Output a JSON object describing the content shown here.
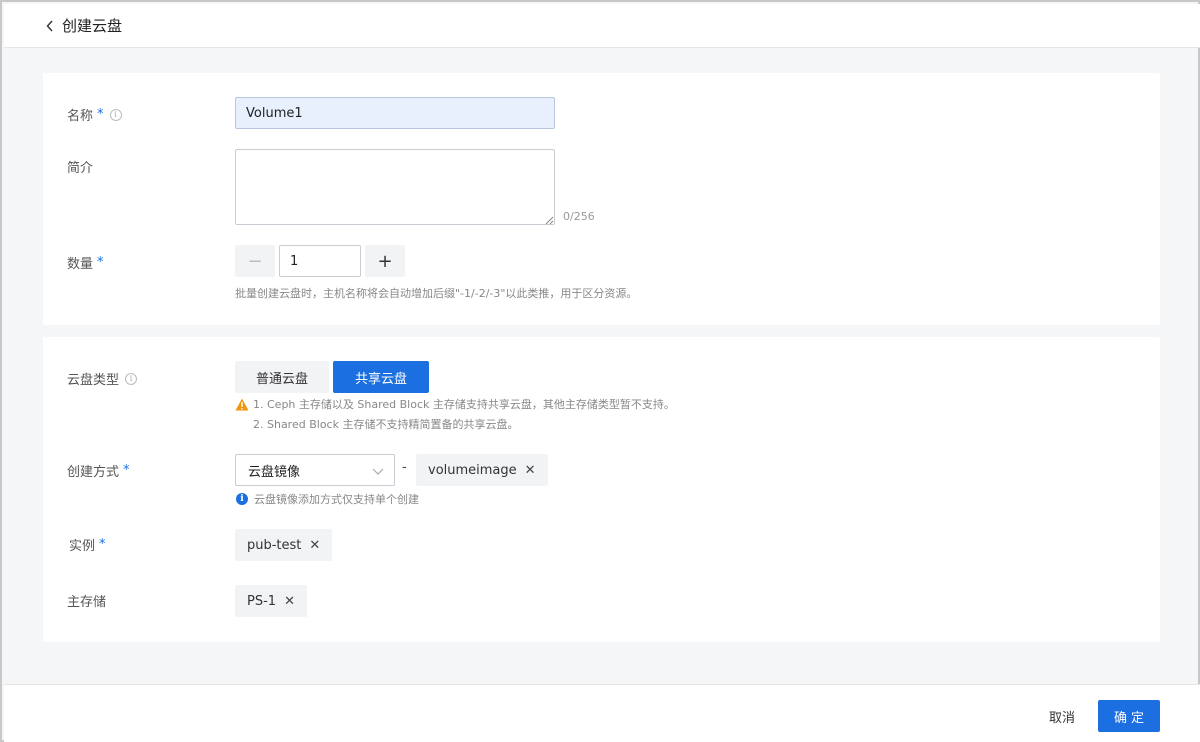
{
  "header": {
    "title": "创建云盘"
  },
  "basic": {
    "name_label": "名称",
    "name_value": "Volume1",
    "desc_label": "简介",
    "desc_value": "",
    "desc_counter": "0/256",
    "qty_label": "数量",
    "qty_value": "1",
    "minus_label": "−",
    "plus_label": "+",
    "qty_hint": "批量创建云盘时，主机名称将会自动增加后缀\"-1/-2/-3\"以此类推，用于区分资源。",
    "required_mark": "*"
  },
  "config": {
    "type_label": "云盘类型",
    "type_options": [
      "普通云盘",
      "共享云盘"
    ],
    "type_selected": "共享云盘",
    "warn_line1": "1. Ceph 主存储以及 Shared Block 主存储支持共享云盘，其他主存储类型暂不支持。",
    "warn_line2": "2. Shared Block 主存储不支持精简置备的共享云盘。",
    "method_label": "创建方式",
    "method_value": "云盘镜像",
    "method_dash": "-",
    "image_tag": "volumeimage",
    "method_hint": "云盘镜像添加方式仅支持单个创建",
    "instance_label": "实例",
    "instance_tag": "pub-test",
    "storage_label": "主存储",
    "storage_tag": "PS-1",
    "tag_remove": "✕"
  },
  "footer": {
    "cancel_label": "取消",
    "ok_label": "确定"
  },
  "colors": {
    "accent": "#1b6fe0",
    "warning": "#f0960e"
  }
}
